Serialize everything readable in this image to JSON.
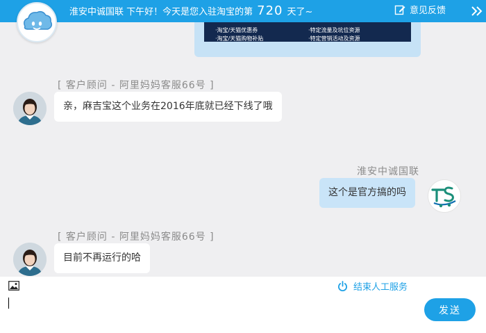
{
  "header": {
    "greeting_prefix": "淮安中诚国联  下午好！今天是您入驻淘宝的第",
    "days": "720",
    "greeting_suffix": "天了~",
    "feedback_label": "意见反馈",
    "background_color": "#1ea1e6"
  },
  "promo": {
    "items_left": [
      "·淘宝/天猫优惠券",
      "·淘宝/天猫购物补贴"
    ],
    "items_right": [
      "·特定流量及坑位资源",
      "·特定营销活动及资源"
    ]
  },
  "messages": [
    {
      "side": "left",
      "sender": "[ 客户顾问  -  阿里妈妈客服66号 ]",
      "text": "亲，麻吉宝这个业务在2016年底就已经下线了哦",
      "avatar": "agent-avatar"
    },
    {
      "side": "right",
      "sender": "淮安中诚国联",
      "text": "这个是官方搞的吗",
      "avatar": "brand-logo-avatar"
    },
    {
      "side": "left",
      "sender": "[ 客户顾问  -  阿里妈妈客服66号 ]",
      "text": "目前不再运行的哈",
      "avatar": "agent-avatar"
    }
  ],
  "input": {
    "image_tool_icon": "image-icon",
    "end_service_label": "结束人工服务",
    "end_service_icon": "power-icon",
    "value": "",
    "placeholder": "",
    "send_label": "发送"
  },
  "colors": {
    "accent": "#1ea1e6",
    "chat_background": "#efeff1",
    "own_bubble": "#c9e4f8",
    "other_bubble": "#ffffff"
  }
}
